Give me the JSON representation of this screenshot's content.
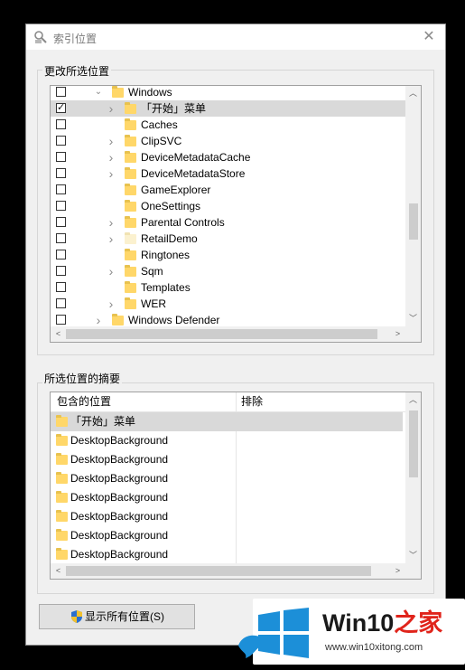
{
  "window": {
    "title": "索引位置",
    "close": "✕"
  },
  "change_section": {
    "legend": "更改所选位置",
    "tree": [
      {
        "label": "Windows",
        "checked": false,
        "expanded": true,
        "depth": 0,
        "has_children": true,
        "selected": false,
        "pale": false
      },
      {
        "label": "「开始」菜单",
        "checked": true,
        "depth": 1,
        "has_children": true,
        "selected": true,
        "pale": false
      },
      {
        "label": "Caches",
        "checked": false,
        "depth": 1,
        "has_children": false,
        "selected": false,
        "pale": false
      },
      {
        "label": "ClipSVC",
        "checked": false,
        "depth": 1,
        "has_children": true,
        "selected": false,
        "pale": false
      },
      {
        "label": "DeviceMetadataCache",
        "checked": false,
        "depth": 1,
        "has_children": true,
        "selected": false,
        "pale": false
      },
      {
        "label": "DeviceMetadataStore",
        "checked": false,
        "depth": 1,
        "has_children": true,
        "selected": false,
        "pale": false
      },
      {
        "label": "GameExplorer",
        "checked": false,
        "depth": 1,
        "has_children": false,
        "selected": false,
        "pale": false
      },
      {
        "label": "OneSettings",
        "checked": false,
        "depth": 1,
        "has_children": false,
        "selected": false,
        "pale": false
      },
      {
        "label": "Parental Controls",
        "checked": false,
        "depth": 1,
        "has_children": true,
        "selected": false,
        "pale": false
      },
      {
        "label": "RetailDemo",
        "checked": false,
        "depth": 1,
        "has_children": true,
        "selected": false,
        "pale": true
      },
      {
        "label": "Ringtones",
        "checked": false,
        "depth": 1,
        "has_children": false,
        "selected": false,
        "pale": false
      },
      {
        "label": "Sqm",
        "checked": false,
        "depth": 1,
        "has_children": true,
        "selected": false,
        "pale": false
      },
      {
        "label": "Templates",
        "checked": false,
        "depth": 1,
        "has_children": false,
        "selected": false,
        "pale": false
      },
      {
        "label": "WER",
        "checked": false,
        "depth": 1,
        "has_children": true,
        "selected": false,
        "pale": false
      },
      {
        "label": "Windows Defender",
        "checked": false,
        "depth": 0,
        "has_children": true,
        "selected": false,
        "pale": false
      }
    ]
  },
  "summary_section": {
    "legend": "所选位置的摘要",
    "columns": [
      "包含的位置",
      "排除"
    ],
    "rows": [
      {
        "included": "「开始」菜单",
        "excluded": "",
        "selected": true
      },
      {
        "included": "DesktopBackground",
        "excluded": "",
        "selected": false
      },
      {
        "included": "DesktopBackground",
        "excluded": "",
        "selected": false
      },
      {
        "included": "DesktopBackground",
        "excluded": "",
        "selected": false
      },
      {
        "included": "DesktopBackground",
        "excluded": "",
        "selected": false
      },
      {
        "included": "DesktopBackground",
        "excluded": "",
        "selected": false
      },
      {
        "included": "DesktopBackground",
        "excluded": "",
        "selected": false
      },
      {
        "included": "DesktopBackground",
        "excluded": "",
        "selected": false
      }
    ]
  },
  "buttons": {
    "show_all": "显示所有位置(S)"
  },
  "watermark": {
    "brand": "Win10",
    "brand_suffix": "之家",
    "url": "www.win10xitong.com"
  },
  "colors": {
    "logo_blue": "#1c8fd8",
    "brand_red": "#e0241b"
  }
}
